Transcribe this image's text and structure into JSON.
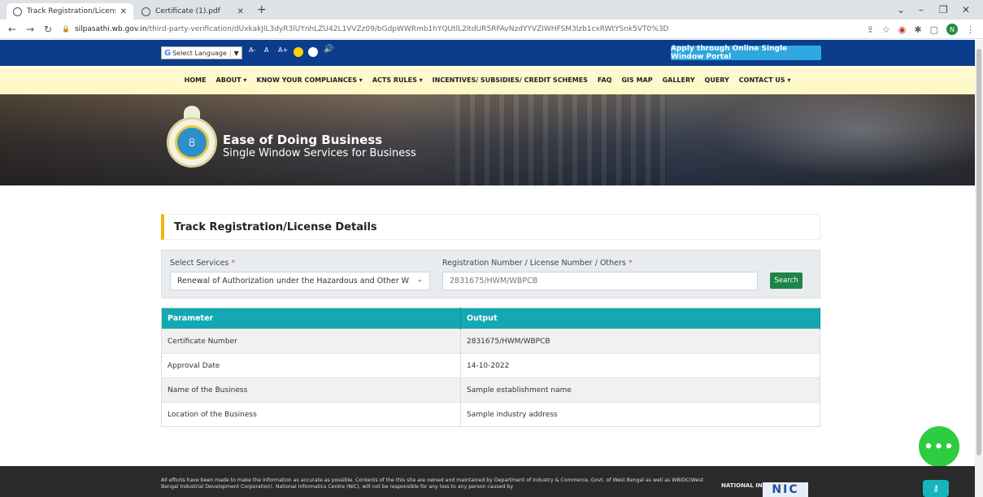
{
  "browser": {
    "tabs": [
      {
        "title": "Track Registration/License Detail",
        "active": true
      },
      {
        "title": "Certificate (1).pdf",
        "active": false
      }
    ],
    "new_tab": "+",
    "url_host": "silpasathi.wb.gov.in",
    "url_path": "/third-party-verification/dUxkakJlL3dyR3lUYnhLZU42L1VVZz09/bGdpWWRmb1hYQUtlL2ltdUR5RFAvNzdYYVZIWHFSM3lzb1cxRWtYSnk5VT0%3D",
    "profile_initial": "N"
  },
  "topbar": {
    "language_label": "Select Language",
    "accessibility": [
      "A-",
      "A",
      "A+"
    ],
    "apply_button": "Apply through Online Single Window Portal",
    "colors": {
      "bar": "#0c3c8c",
      "apply": "#2fa7e0",
      "yellow_dot": "#ffd400",
      "white_dot": "#ffffff"
    }
  },
  "nav": {
    "items": [
      "HOME",
      "ABOUT ▾",
      "KNOW YOUR COMPLIANCES ▾",
      "ACTS RULES ▾",
      "INCENTIVES/ SUBSIDIES/ CREDIT SCHEMES",
      "FAQ",
      "GIS MAP",
      "GALLERY",
      "QUERY",
      "CONTACT US ▾"
    ]
  },
  "banner": {
    "title": "Ease of Doing Business",
    "subtitle": "Single Window Services for Business"
  },
  "main": {
    "section_title": "Track Registration/License Details",
    "form": {
      "services_label": "Select Services",
      "services_value": "Renewal of Authorization under the Hazardous and Other W",
      "registration_label": "Registration Number / License Number / Others",
      "registration_value": "2831675/HWM/WBPCB",
      "required_mark": "*",
      "search_button": "Search"
    },
    "table": {
      "headers": [
        "Parameter",
        "Output"
      ],
      "rows": [
        [
          "Certificate Number",
          "2831675/HWM/WBPCB"
        ],
        [
          "Approval Date",
          "14-10-2022"
        ],
        [
          "Name of the Business",
          "Sample establishment name"
        ],
        [
          "Location of the Business",
          "Sample industry address"
        ]
      ]
    }
  },
  "footer": {
    "text": "All efforts have been made to make the information as accurate as possible. Contents of the this site are owned and maintained by Department of Industry & Commerce, Govt. of West Bengal as well as WBIDC(West Bengal Industrial Development Corporation). National Informatics Centre (NIC), will not be responsible for any loss to any person caused by",
    "nic_label": "NATIONAL INFORMATICS",
    "nic_logo": "NIC"
  },
  "chat": {
    "dots": "•••"
  }
}
